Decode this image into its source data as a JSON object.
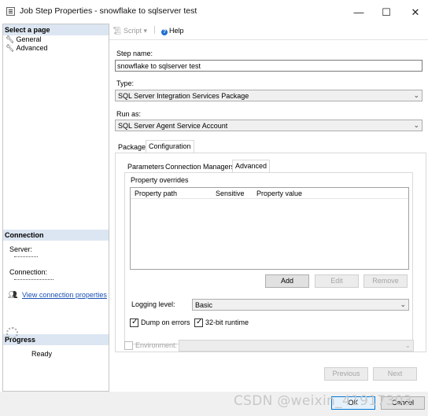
{
  "window": {
    "title": "Job Step Properties - snowflake to sqlserver test",
    "minimize": "—",
    "maximize": "☐",
    "close": "✕"
  },
  "left": {
    "select_page_header": "Select a page",
    "pages": [
      {
        "label": "General"
      },
      {
        "label": "Advanced"
      }
    ],
    "connection_header": "Connection",
    "server_label": "Server:",
    "connection_label": "Connection:",
    "view_connection_link": "View connection properties",
    "progress_header": "Progress",
    "progress_status": "Ready"
  },
  "toolbar": {
    "script_label": "Script",
    "help_label": "Help"
  },
  "form": {
    "step_name_label": "Step name:",
    "step_name_value": "snowflake to sqlserver test",
    "type_label": "Type:",
    "type_value": "SQL Server Integration Services Package",
    "run_as_label": "Run as:",
    "run_as_value": "SQL Server Agent Service Account"
  },
  "tabs_outer": [
    {
      "label": "Package"
    },
    {
      "label": "Configuration"
    }
  ],
  "tabs_inner": [
    {
      "label": "Parameters"
    },
    {
      "label": "Connection Managers"
    },
    {
      "label": "Advanced"
    }
  ],
  "advanced": {
    "property_overrides_label": "Property overrides",
    "columns": [
      "Property path",
      "Sensitive",
      "Property value"
    ],
    "add_button": "Add",
    "edit_button": "Edit",
    "remove_button": "Remove",
    "logging_level_label": "Logging level:",
    "logging_level_value": "Basic",
    "dump_on_errors_label": "Dump on errors",
    "runtime_32bit_label": "32-bit runtime"
  },
  "environment": {
    "label": "Environment:",
    "value": ""
  },
  "nav_buttons": {
    "previous": "Previous",
    "next": "Next"
  },
  "footer": {
    "ok": "OK",
    "cancel": "Cancel"
  },
  "watermark": "CSDN @weixin_41917303",
  "colors": {
    "section_header_bg": "#dce6f2",
    "link": "#1a4fb5",
    "help_icon": "#1f6fcf"
  }
}
